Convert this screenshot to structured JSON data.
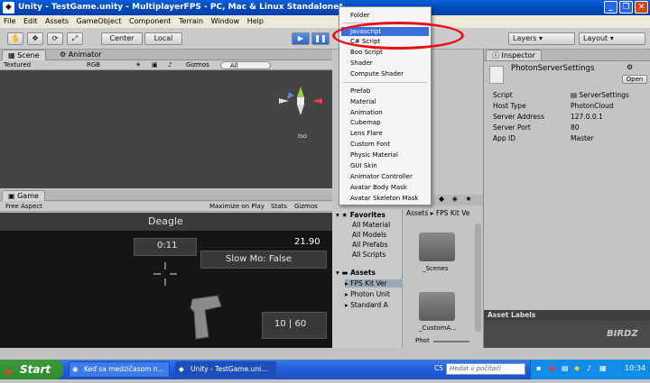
{
  "window": {
    "title": "Unity - TestGame.unity - MultiplayerFPS - PC, Mac & Linux Standalone*"
  },
  "menubar": [
    "File",
    "Edit",
    "Assets",
    "GameObject",
    "Component",
    "Terrain",
    "Window",
    "Help"
  ],
  "toolbar": {
    "center": "Center",
    "local": "Local",
    "layers": "Layers",
    "layout": "Layout"
  },
  "scene": {
    "tab_scene": "Scene",
    "tab_animator": "Animator",
    "textured": "Textured",
    "rgb": "RGB",
    "gizmos": "Gizmos",
    "search_placeholder": "All",
    "persp": "Iso"
  },
  "game": {
    "tab": "Game",
    "aspect": "Free Aspect",
    "maximize": "Maximize on Play",
    "stats": "Stats",
    "gizmos": "Gizmos",
    "weapon": "Deagle",
    "timer": "0:11",
    "score": "21.90",
    "slowmo": "Slow Mo: False",
    "ammo": "10 | 60"
  },
  "create_menu": {
    "items": [
      "Folder",
      "Javascript",
      "C# Script",
      "Boo Script",
      "Shader",
      "Compute Shader",
      "Prefab",
      "Material",
      "Animation",
      "Cubemap",
      "Lens Flare",
      "Custom Font",
      "Physic Material",
      "GUI Skin",
      "Animator Controller",
      "Avatar Body Mask",
      "Avatar Skeleton Mask"
    ],
    "selected": "Javascript"
  },
  "project": {
    "favorites": "Favorites",
    "fav_items": [
      "All Material",
      "All Models",
      "All Prefabs",
      "All Scripts"
    ],
    "assets": "Assets",
    "asset_items": [
      "FPS Kit Ver",
      "Photon Unit",
      "Standard A"
    ],
    "breadcrumb": "Assets ▸ FPS Kit Ve",
    "folder1": "_Scenes",
    "folder2": "_CustomA...",
    "zoom_label": "Phot"
  },
  "inspector": {
    "tab": "Inspector",
    "object": "PhotonServerSettings",
    "open": "Open",
    "rows": [
      {
        "k": "Script",
        "v": "ServerSettings"
      },
      {
        "k": "Host Type",
        "v": "PhotonCloud"
      },
      {
        "k": "Server Address",
        "v": "127.0.0.1"
      },
      {
        "k": "Server Port",
        "v": "80"
      },
      {
        "k": "App ID",
        "v": "Master"
      }
    ],
    "asset_labels": "Asset Labels"
  },
  "taskbar": {
    "start": "Start",
    "task1": "Keď sa medzičasom n...",
    "task2": "Unity - TestGame.uni...",
    "lang": "CS",
    "search_placeholder": "Hedat v počítači",
    "clock": "10:34"
  },
  "watermark": "BIRDZ"
}
